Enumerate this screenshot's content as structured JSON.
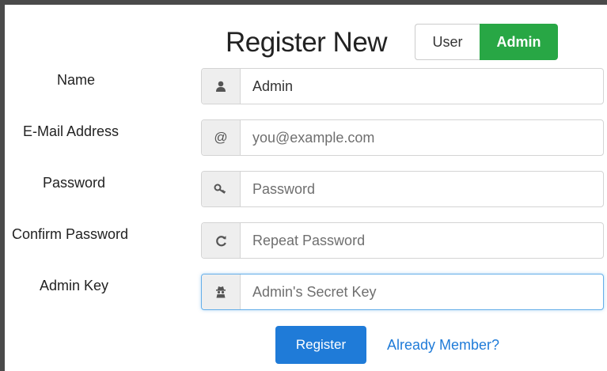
{
  "header": {
    "title": "Register New",
    "toggle": {
      "user_label": "User",
      "admin_label": "Admin",
      "selected": "Admin"
    }
  },
  "form": {
    "name": {
      "label": "Name",
      "value": "Admin",
      "icon": "user-icon"
    },
    "email": {
      "label": "E-Mail Address",
      "placeholder": "you@example.com",
      "icon": "at-icon"
    },
    "password": {
      "label": "Password",
      "placeholder": "Password",
      "icon": "key-icon"
    },
    "confirm_password": {
      "label": "Confirm Password",
      "placeholder": "Repeat Password",
      "icon": "refresh-icon"
    },
    "admin_key": {
      "label": "Admin Key",
      "placeholder": "Admin's Secret Key",
      "icon": "spy-icon"
    }
  },
  "actions": {
    "register_label": "Register",
    "already_member_label": "Already Member?"
  },
  "colors": {
    "accent_green": "#28a745",
    "primary_blue": "#1f7bd8",
    "focus_border": "#66afe9"
  }
}
